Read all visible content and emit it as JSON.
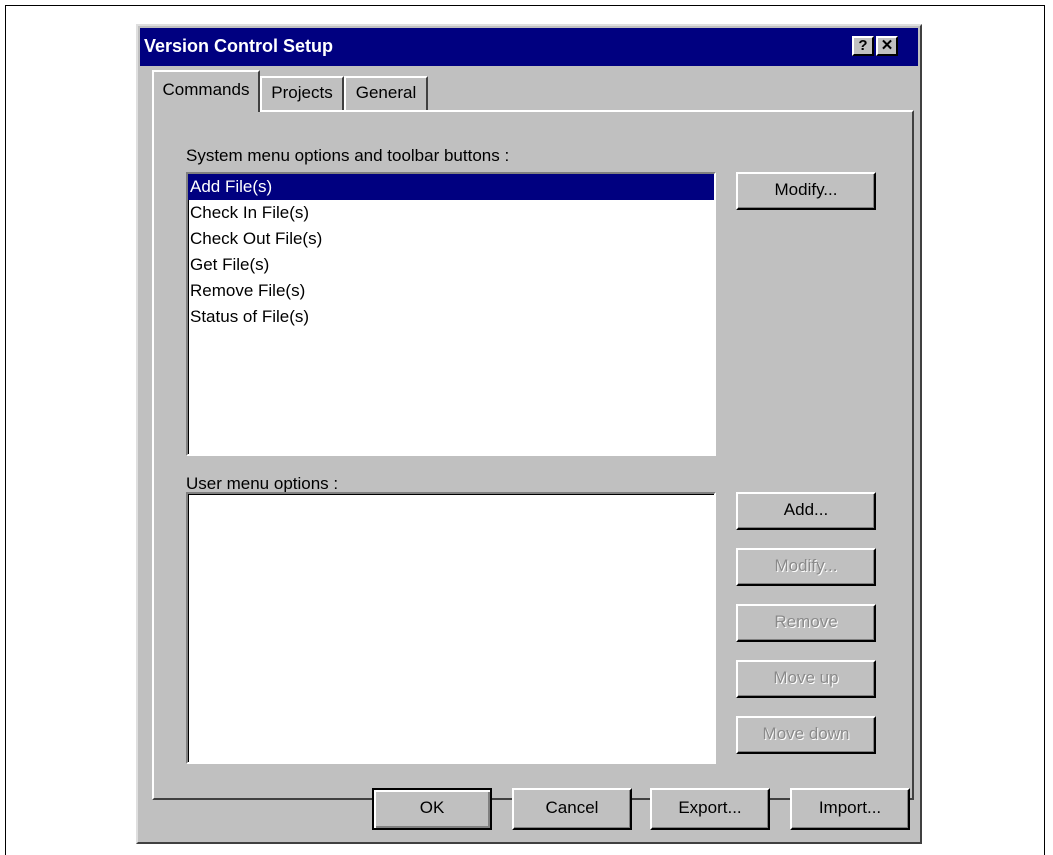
{
  "window": {
    "title": "Version Control Setup",
    "help_glyph": "?",
    "close_glyph": "✕"
  },
  "tabs": [
    {
      "label": "Commands",
      "active": true
    },
    {
      "label": "Projects",
      "active": false
    },
    {
      "label": "General",
      "active": false
    }
  ],
  "system_section": {
    "label": "System menu options and toolbar buttons :",
    "items": [
      {
        "label": "Add File(s)",
        "selected": true
      },
      {
        "label": "Check In File(s)",
        "selected": false
      },
      {
        "label": "Check Out File(s)",
        "selected": false
      },
      {
        "label": "Get File(s)",
        "selected": false
      },
      {
        "label": "Remove File(s)",
        "selected": false
      },
      {
        "label": "Status of File(s)",
        "selected": false
      }
    ],
    "modify_label": "Modify..."
  },
  "user_section": {
    "label": "User menu options :",
    "items": [],
    "add_label": "Add...",
    "modify_label": "Modify...",
    "remove_label": "Remove",
    "move_up_label": "Move up",
    "move_down_label": "Move down"
  },
  "footer": {
    "ok_label": "OK",
    "cancel_label": "Cancel",
    "export_label": "Export...",
    "import_label": "Import..."
  }
}
